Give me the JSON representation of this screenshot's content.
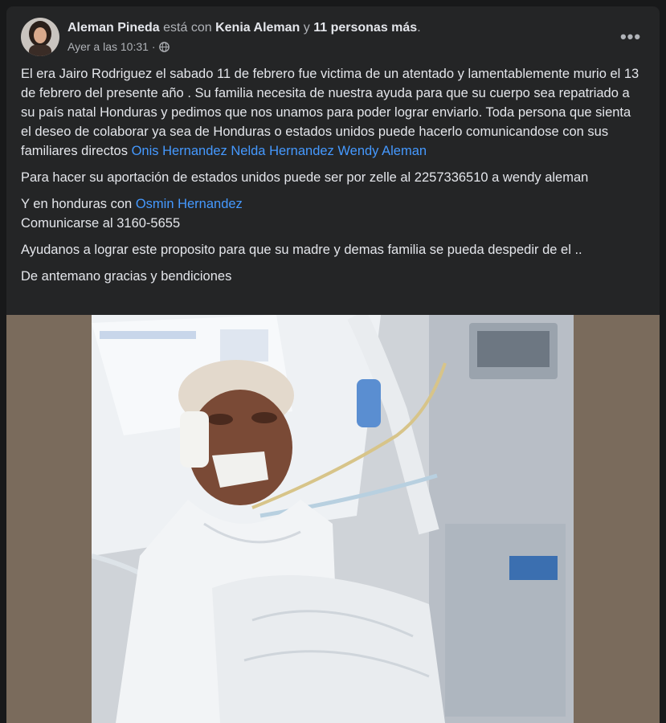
{
  "post": {
    "author": "Aleman Pineda",
    "with_text": "está con",
    "tagged": "Kenia Aleman",
    "and_text": "y",
    "others": "11 personas más",
    "period": ".",
    "timestamp": "Ayer a las 10:31",
    "dot": "·",
    "more_label": "•••",
    "paragraphs": {
      "p1_text": "El era Jairo Rodriguez el sabado 11 de febrero fue victima de un atentado y lamentablemente murio el 13 de febrero del presente año . Su familia necesita de nuestra ayuda para que su cuerpo sea repatriado a su país natal Honduras y pedimos que nos unamos para poder lograr enviarlo. Toda persona que sienta el deseo de colaborar ya sea de Honduras o estados unidos puede hacerlo comunicandose con sus familiares directos",
      "p1_link": "Onis Hernandez Nelda Hernandez Wendy Aleman",
      "p2": "Para hacer su aportación de estados unidos puede ser por zelle al 2257336510 a wendy aleman",
      "p3_text": "Y en honduras con",
      "p3_link": "Osmin Hernandez",
      "p3_line2": "Comunicarse al 3160-5655",
      "p4": "Ayudanos a lograr este proposito para que su madre y demas familia se pueda despedir de el ..",
      "p5": "De antemano gracias y bendiciones"
    }
  },
  "colors": {
    "background": "#18191a",
    "card": "#242526",
    "text": "#e4e6eb",
    "muted": "#b0b3b8",
    "link": "#4599ff"
  },
  "icons": [
    "avatar-photo",
    "globe-icon",
    "more-options-icon"
  ]
}
